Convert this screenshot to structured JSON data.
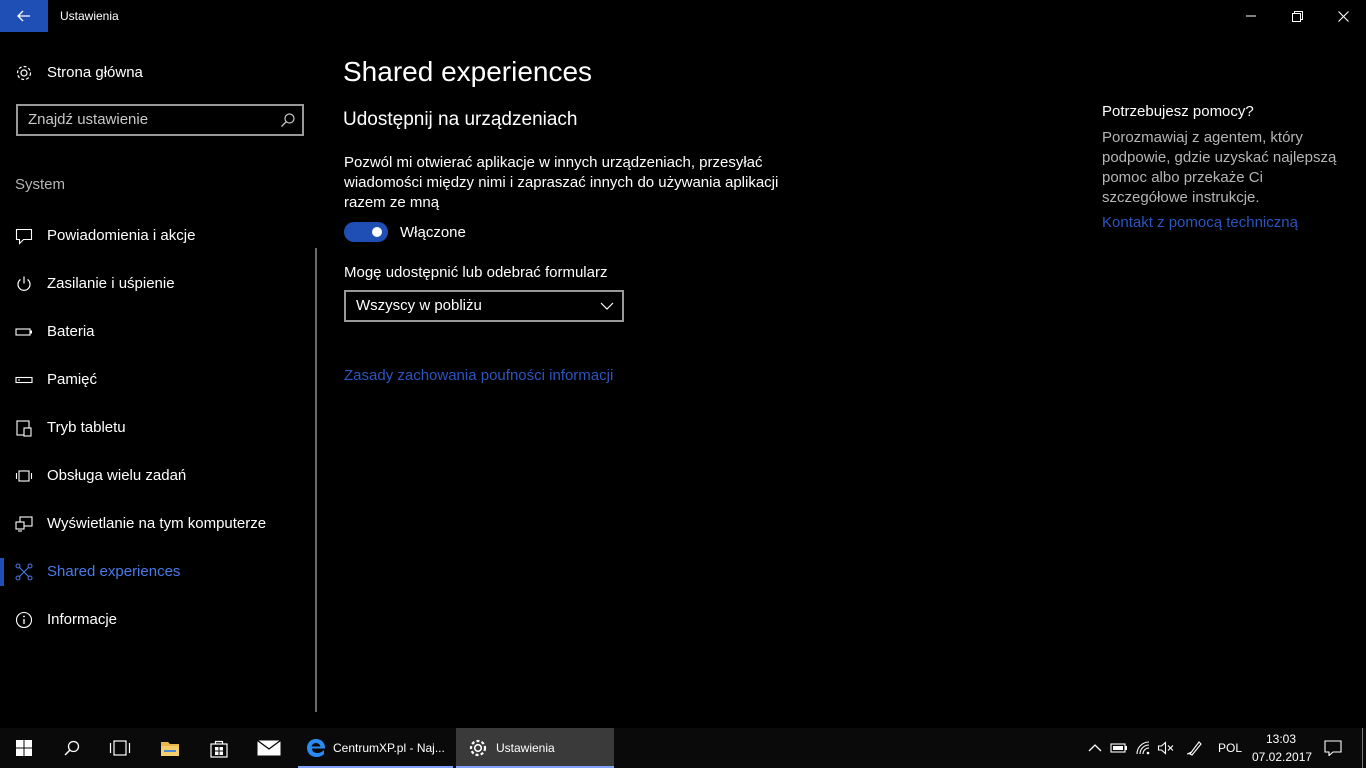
{
  "window": {
    "title": "Ustawienia",
    "back_icon": "back-arrow-icon",
    "minimize_icon": "minimize-icon",
    "restore_icon": "restore-icon",
    "close_icon": "close-icon"
  },
  "sidebar": {
    "home_label": "Strona główna",
    "search_placeholder": "Znajdź ustawienie",
    "section_label": "System",
    "items": [
      {
        "label": "Powiadomienia i akcje",
        "icon": "notification-icon"
      },
      {
        "label": "Zasilanie i uśpienie",
        "icon": "power-icon"
      },
      {
        "label": "Bateria",
        "icon": "battery-icon"
      },
      {
        "label": "Pamięć",
        "icon": "storage-icon"
      },
      {
        "label": "Tryb tabletu",
        "icon": "tablet-icon"
      },
      {
        "label": "Obsługa wielu zadań",
        "icon": "multitasking-icon"
      },
      {
        "label": "Wyświetlanie na tym komputerze",
        "icon": "project-icon"
      },
      {
        "label": "Shared experiences",
        "icon": "shared-experiences-icon",
        "active": true
      },
      {
        "label": "Informacje",
        "icon": "info-icon"
      }
    ]
  },
  "main": {
    "title": "Shared experiences",
    "subtitle": "Udostępnij na urządzeniach",
    "description": "Pozwól mi otwierać aplikacje w innych urządzeniach, przesyłać wiadomości między nimi i zapraszać innych do używania aplikacji razem ze mną",
    "toggle_label": "Włączone",
    "toggle_on": true,
    "dropdown_label": "Mogę udostępnić lub odebrać formularz",
    "dropdown_value": "Wszyscy w pobliżu",
    "privacy_link": "Zasady zachowania poufności informacji"
  },
  "help": {
    "title": "Potrzebujesz pomocy?",
    "text": "Porozmawiaj z agentem, który podpowie, gdzie uzyskać najlepszą pomoc albo przekaże Ci szczegółowe instrukcje.",
    "link": "Kontakt z pomocą techniczną"
  },
  "taskbar": {
    "edge_label": "CentrumXP.pl - Naj...",
    "settings_label": "Ustawienia",
    "language": "POL",
    "time": "13:03",
    "date": "07.02.2017"
  },
  "colors": {
    "accent": "#1f4fb5",
    "link": "#2d55c0",
    "active_nav": "#4a7ae8"
  }
}
